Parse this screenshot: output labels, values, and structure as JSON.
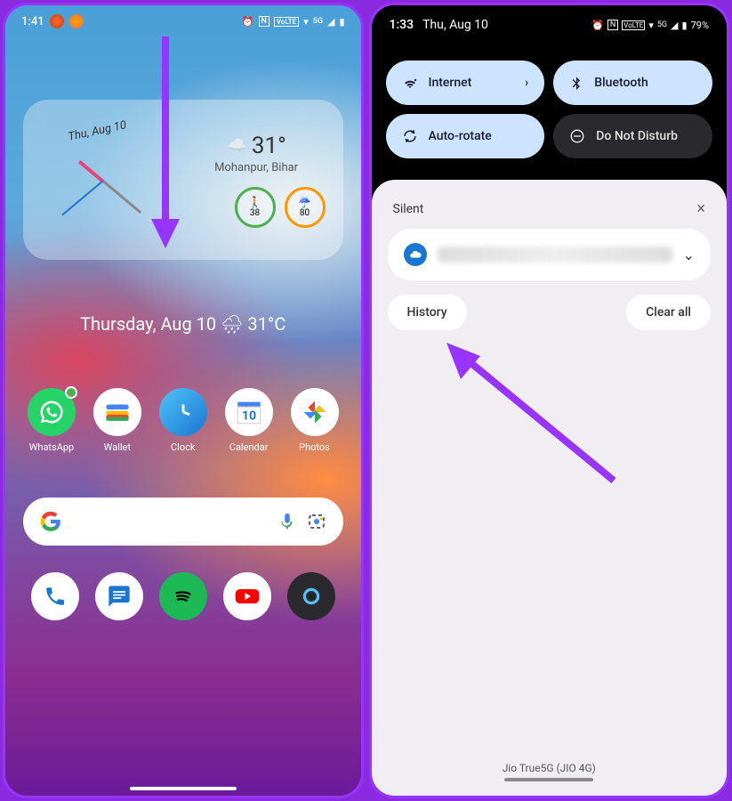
{
  "left": {
    "status": {
      "time": "1:41",
      "volte": "VoLTE",
      "network": "5G"
    },
    "widget": {
      "date": "Thu, Aug 10",
      "temp": "31°",
      "location": "Mohanpur, Bihar",
      "steps": "38",
      "humidity": "80"
    },
    "dateline": "Thursday, Aug 10 🌧 31°C",
    "apps": [
      {
        "label": "WhatsApp"
      },
      {
        "label": "Wallet"
      },
      {
        "label": "Clock"
      },
      {
        "label": "Calendar"
      },
      {
        "label": "Photos"
      }
    ]
  },
  "right": {
    "status": {
      "time": "1:33",
      "date": "Thu, Aug 10",
      "battery": "79%",
      "network": "5G"
    },
    "qs": {
      "internet": "Internet",
      "bluetooth": "Bluetooth",
      "autorotate": "Auto-rotate",
      "dnd": "Do Not Disturb"
    },
    "silent": "Silent",
    "history": "History",
    "clearall": "Clear all",
    "carrier": "Jio True5G (JIO 4G)"
  }
}
